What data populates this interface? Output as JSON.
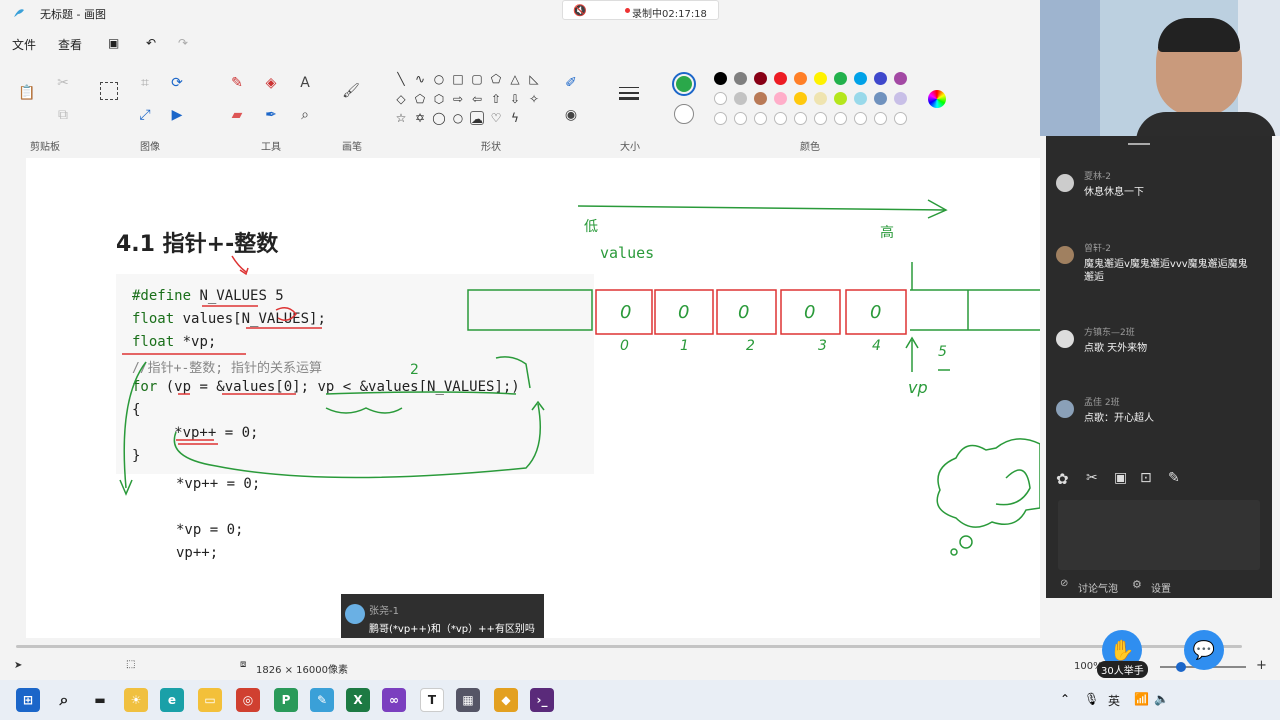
{
  "window": {
    "title": "无标题 - 画图"
  },
  "recording": {
    "status": "录制中02:17:18"
  },
  "menubar": {
    "file": "文件",
    "view": "查看"
  },
  "ribbon": {
    "groups": {
      "clipboard": "剪贴板",
      "image": "图像",
      "tools": "工具",
      "brush": "画笔",
      "shapes": "形状",
      "size": "大小",
      "colors": "颜色"
    },
    "colors": {
      "primary": "#2aa84a",
      "row1": [
        "#000000",
        "#7f7f7f",
        "#880015",
        "#ed1c24",
        "#ff7f27",
        "#fff200",
        "#22b14c",
        "#00a2e8",
        "#3f48cc",
        "#a349a4"
      ],
      "row2": [
        "#ffffff",
        "#c3c3c3",
        "#b97a57",
        "#ffaec9",
        "#ffc90e",
        "#efe4b0",
        "#b5e61d",
        "#99d9ea",
        "#7092be",
        "#c8bfe7"
      ]
    }
  },
  "canvas": {
    "heading": "4.1 指针+-整数",
    "code": {
      "line1_kw": "#define",
      "line1_rest": " N_VALUES 5",
      "line2_kw": "float",
      "line2_rest": " values[N_VALUES];",
      "line3_kw": "float",
      "line3_rest": " *vp;",
      "line4": "//指针+-整数; 指针的关系运算",
      "line5_kw": "for",
      "line5_rest": " (vp = &values[0]; vp < &values[N_VALUES];)",
      "line6": "{",
      "line7": "     *vp++ = 0;",
      "line8": "}",
      "alt1": "*vp++ = 0;",
      "alt2": "*vp = 0;",
      "alt3": "vp++;"
    },
    "annotations": {
      "low": "低",
      "high": "高",
      "values_label": "values",
      "cells": [
        "0",
        "0",
        "0",
        "0",
        "0"
      ],
      "indices": [
        "0",
        "1",
        "2",
        "3",
        "4",
        "5"
      ],
      "vp_label": "vp",
      "two": "2"
    }
  },
  "bubble": {
    "name": "张尧-1",
    "text": "鹏哥(*vp++)和（*vp）++有区别吗"
  },
  "chat": {
    "messages": [
      {
        "name": "夏林-2",
        "text": "休息休息一下"
      },
      {
        "name": "曾轩-2",
        "text": "魔鬼邂逅v魔鬼邂逅vvv魔鬼邂逅魔鬼邂逅"
      },
      {
        "name": "方镇东—2班",
        "text": "点歌 天外来物"
      },
      {
        "name": "孟佳 2班",
        "text": "点歌：开心超人"
      }
    ],
    "footer_left": "讨论气泡",
    "footer_right": "设置"
  },
  "statusbar": {
    "canvas_size": "1826 × 16000像素",
    "zoom": "100%",
    "hands_raised": "30人举手"
  },
  "taskbar": {
    "ime": "英"
  }
}
